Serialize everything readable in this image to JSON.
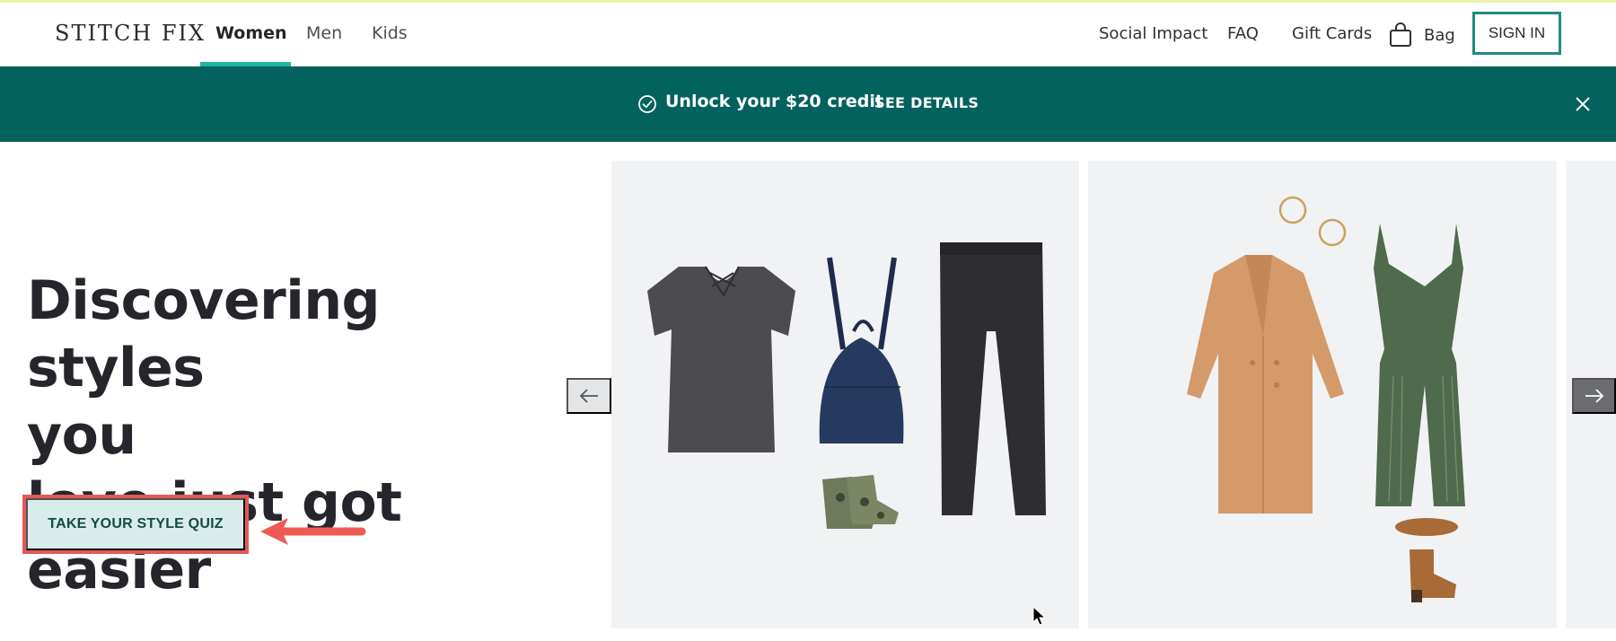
{
  "header": {
    "logo": "STITCH FIX",
    "categories": [
      {
        "label": "Women",
        "active": true
      },
      {
        "label": "Men",
        "active": false
      },
      {
        "label": "Kids",
        "active": false
      }
    ],
    "links": [
      "Social Impact",
      "FAQ",
      "Gift Cards"
    ],
    "bag_label": "Bag",
    "sign_in_label": "SIGN IN"
  },
  "promo": {
    "icon": "check-circle-icon",
    "text": "Unlock your $20 credit",
    "link_label": "SEE DETAILS",
    "close_icon": "close-icon"
  },
  "hero": {
    "headline_lines": [
      "Discovering styles",
      "you",
      "love just got easier"
    ],
    "cta_label": "TAKE YOUR STYLE QUIZ"
  },
  "carousel": {
    "prev_icon": "arrow-left-icon",
    "next_icon": "arrow-right-icon",
    "cards": [
      {
        "items": [
          "charcoal strappy-neck tee",
          "navy leather backpack",
          "black skinny jeans",
          "camo ankle booties"
        ]
      },
      {
        "items": [
          "gold hoop earrings",
          "camel long coat",
          "green striped wrap jumpsuit",
          "cognac chelsea boots"
        ]
      },
      {
        "items": []
      }
    ]
  },
  "colors": {
    "brand_teal": "#04625e",
    "accent_teal": "#1fb5a2",
    "signin_border": "#1f8b84",
    "cta_bg": "#d9ecec",
    "annotation_red": "#e05a57"
  }
}
